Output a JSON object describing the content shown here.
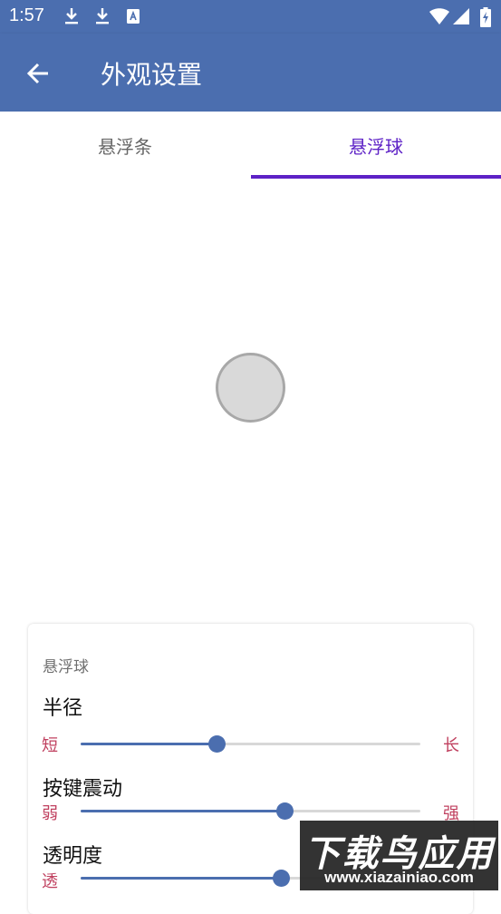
{
  "status_bar": {
    "time": "1:57",
    "icons": [
      "download-icon",
      "download-icon",
      "keyboard-icon",
      "wifi-icon",
      "signal-icon",
      "battery-charging-icon"
    ]
  },
  "app_bar": {
    "title": "外观设置",
    "back_icon": "arrow-back-icon"
  },
  "tabs": [
    {
      "label": "悬浮条",
      "selected": false
    },
    {
      "label": "悬浮球",
      "selected": true
    }
  ],
  "colors": {
    "primary": "#4b6eaf",
    "tab_accent": "#5d21c6",
    "end_label": "#c0405f"
  },
  "card": {
    "title": "悬浮球",
    "settings": [
      {
        "label": "半径",
        "min_label": "短",
        "max_label": "长",
        "value": 0.4
      },
      {
        "label": "按键震动",
        "min_label": "弱",
        "max_label": "强",
        "value": 0.6
      },
      {
        "label": "透明度",
        "min_label": "透",
        "max_label": "",
        "value": 0.59
      }
    ]
  },
  "watermark": {
    "main": "下载鸟应用",
    "url": "www.xiazainiao.com"
  }
}
